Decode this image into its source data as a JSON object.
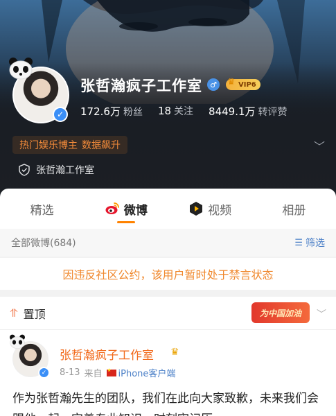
{
  "header": {
    "profile_name": "张哲瀚疯子工作室",
    "vip_label": "VIP6",
    "stats": [
      {
        "value": "172.6万",
        "label": "粉丝"
      },
      {
        "value": "18",
        "label": "关注"
      },
      {
        "value": "8449.1万",
        "label": "转评赞"
      }
    ],
    "hot_tags": [
      "热门娱乐博主",
      "数据飙升"
    ],
    "studio_label": "张哲瀚工作室"
  },
  "tabs": [
    {
      "label": "精选",
      "active": false
    },
    {
      "label": "微博",
      "active": true,
      "icon": "weibo-icon"
    },
    {
      "label": "视频",
      "active": false,
      "icon": "video-icon"
    },
    {
      "label": "相册",
      "active": false
    }
  ],
  "filter": {
    "all_label": "全部微博(684)",
    "filter_label": "筛选"
  },
  "notice": {
    "text": "因违反社区公约，该用户暂时处于禁言状态"
  },
  "pinned": {
    "label": "置顶",
    "campaign_badge": "为中国加油"
  },
  "post": {
    "author": "张哲瀚疯子工作室",
    "date": "8-13",
    "source_prefix": "来自",
    "client": "iPhone客户端",
    "body": "作为张哲瀚先生的团队，我们在此向大家致歉，未来我们会跟他一起，完善专业知识，时刻牢记历"
  },
  "colors": {
    "accent_orange": "#ff8200",
    "link_blue": "#4a7fc7",
    "notice_orange": "#f0882d",
    "author_orange": "#f26b1d"
  }
}
